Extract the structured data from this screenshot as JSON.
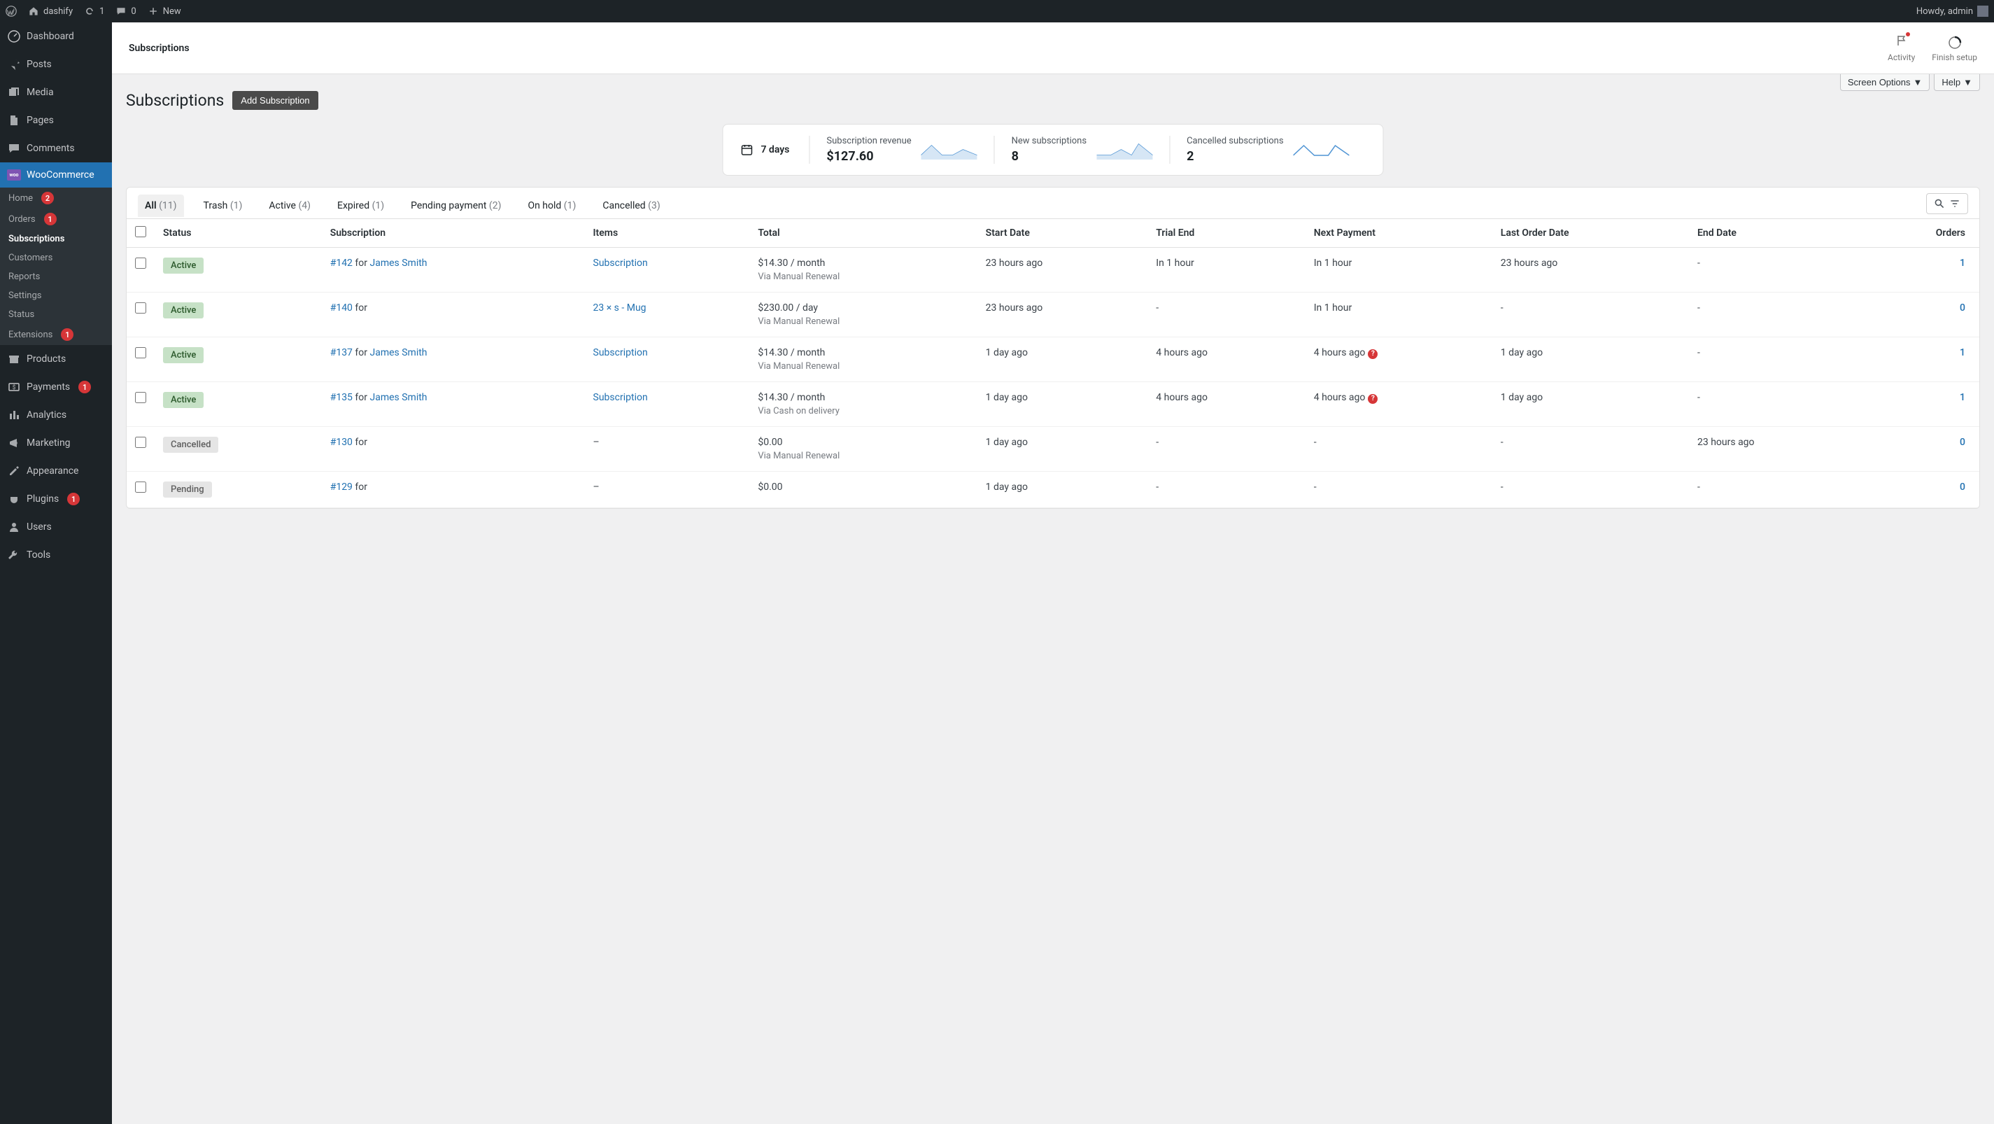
{
  "admin_bar": {
    "site_name": "dashify",
    "refresh_count": "1",
    "comments_count": "0",
    "new_label": "New",
    "howdy": "Howdy, admin"
  },
  "sidebar": {
    "dashboard": "Dashboard",
    "posts": "Posts",
    "media": "Media",
    "pages": "Pages",
    "comments": "Comments",
    "woocommerce": "WooCommerce",
    "woo_sub": {
      "home": {
        "label": "Home",
        "badge": "2"
      },
      "orders": {
        "label": "Orders",
        "badge": "1"
      },
      "subscriptions": {
        "label": "Subscriptions"
      },
      "customers": {
        "label": "Customers"
      },
      "reports": {
        "label": "Reports"
      },
      "settings": {
        "label": "Settings"
      },
      "status": {
        "label": "Status"
      },
      "extensions": {
        "label": "Extensions",
        "badge": "1"
      }
    },
    "products": "Products",
    "payments": {
      "label": "Payments",
      "badge": "1"
    },
    "analytics": "Analytics",
    "marketing": "Marketing",
    "appearance": "Appearance",
    "plugins": {
      "label": "Plugins",
      "badge": "1"
    },
    "users": "Users",
    "tools": "Tools"
  },
  "header": {
    "title": "Subscriptions",
    "activity": "Activity",
    "finish_setup": "Finish setup"
  },
  "top_options": {
    "screen_options": "Screen Options",
    "help": "Help"
  },
  "page": {
    "title": "Subscriptions",
    "add_button": "Add Subscription"
  },
  "stats": {
    "period": "7 days",
    "revenue_label": "Subscription revenue",
    "revenue_value": "$127.60",
    "new_label": "New subscriptions",
    "new_value": "8",
    "cancelled_label": "Cancelled subscriptions",
    "cancelled_value": "2"
  },
  "tabs": [
    {
      "label": "All",
      "count": "(11)",
      "active": true
    },
    {
      "label": "Trash",
      "count": "(1)"
    },
    {
      "label": "Active",
      "count": "(4)"
    },
    {
      "label": "Expired",
      "count": "(1)"
    },
    {
      "label": "Pending payment",
      "count": "(2)"
    },
    {
      "label": "On hold",
      "count": "(1)"
    },
    {
      "label": "Cancelled",
      "count": "(3)"
    }
  ],
  "columns": {
    "status": "Status",
    "subscription": "Subscription",
    "items": "Items",
    "total": "Total",
    "start_date": "Start Date",
    "trial_end": "Trial End",
    "next_payment": "Next Payment",
    "last_order_date": "Last Order Date",
    "end_date": "End Date",
    "orders": "Orders"
  },
  "rows": [
    {
      "status": "Active",
      "status_class": "active",
      "sub_id": "#142",
      "for": " for ",
      "customer": "James Smith",
      "items": "Subscription",
      "items_is_link": true,
      "total": "$14.30 / month",
      "via": "Via Manual Renewal",
      "start_date": "23 hours ago",
      "trial_end": "In 1 hour",
      "next_payment": "In 1 hour",
      "next_warn": false,
      "last_order": "23 hours ago",
      "end_date": "-",
      "orders": "1"
    },
    {
      "status": "Active",
      "status_class": "active",
      "sub_id": "#140",
      "for": " for",
      "customer": "",
      "items": "23 × s - Mug",
      "items_is_link": true,
      "total": "$230.00 / day",
      "via": "Via Manual Renewal",
      "start_date": "23 hours ago",
      "trial_end": "-",
      "next_payment": "In 1 hour",
      "next_warn": false,
      "last_order": "-",
      "end_date": "-",
      "orders": "0"
    },
    {
      "status": "Active",
      "status_class": "active",
      "sub_id": "#137",
      "for": " for ",
      "customer": "James Smith",
      "items": "Subscription",
      "items_is_link": true,
      "total": "$14.30 / month",
      "via": "Via Manual Renewal",
      "start_date": "1 day ago",
      "trial_end": "4 hours ago",
      "next_payment": "4 hours ago",
      "next_warn": true,
      "last_order": "1 day ago",
      "end_date": "-",
      "orders": "1"
    },
    {
      "status": "Active",
      "status_class": "active",
      "sub_id": "#135",
      "for": " for ",
      "customer": "James Smith",
      "items": "Subscription",
      "items_is_link": true,
      "total": "$14.30 / month",
      "via": "Via Cash on delivery",
      "start_date": "1 day ago",
      "trial_end": "4 hours ago",
      "next_payment": "4 hours ago",
      "next_warn": true,
      "last_order": "1 day ago",
      "end_date": "-",
      "orders": "1"
    },
    {
      "status": "Cancelled",
      "status_class": "cancelled",
      "sub_id": "#130",
      "for": " for",
      "customer": "",
      "items": "–",
      "items_is_link": false,
      "total": "$0.00",
      "via": "Via Manual Renewal",
      "start_date": "1 day ago",
      "trial_end": "-",
      "next_payment": "-",
      "next_warn": false,
      "last_order": "-",
      "end_date": "23 hours ago",
      "orders": "0"
    },
    {
      "status": "Pending",
      "status_class": "pending",
      "sub_id": "#129",
      "for": " for",
      "customer": "",
      "items": "–",
      "items_is_link": false,
      "total": "$0.00",
      "via": "",
      "start_date": "1 day ago",
      "trial_end": "-",
      "next_payment": "-",
      "next_warn": false,
      "last_order": "-",
      "end_date": "-",
      "orders": "0"
    }
  ]
}
